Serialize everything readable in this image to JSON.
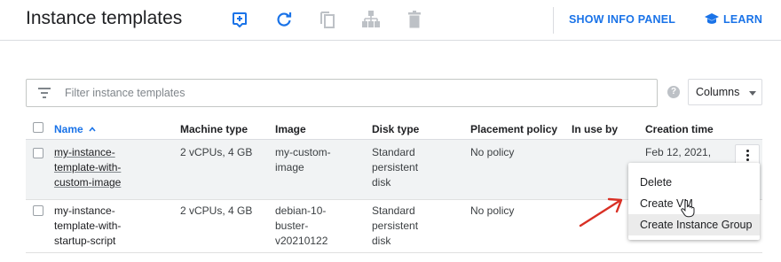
{
  "header": {
    "title": "Instance templates",
    "actions": [
      {
        "icon": "add-box-icon",
        "color": "#1a73e8"
      },
      {
        "icon": "refresh-icon",
        "color": "#1a73e8"
      },
      {
        "icon": "copy-icon",
        "color": "#bdc1c6"
      },
      {
        "icon": "instance-group-icon",
        "color": "#bdc1c6"
      },
      {
        "icon": "delete-icon",
        "color": "#bdc1c6"
      }
    ],
    "show_info_panel": "SHOW INFO PANEL",
    "learn": "LEARN"
  },
  "filter": {
    "placeholder": "Filter instance templates",
    "columns_label": "Columns"
  },
  "table": {
    "columns": [
      "Name",
      "Machine type",
      "Image",
      "Disk type",
      "Placement policy",
      "In use by",
      "Creation time"
    ],
    "sort_indicator": "^",
    "rows": [
      {
        "name": "my-instance-template-with-custom-image",
        "machine_type": "2 vCPUs, 4 GB",
        "image": "my-custom-image",
        "disk_type": "Standard persistent disk",
        "placement_policy": "No policy",
        "in_use_by": "",
        "creation_time": "Feb 12, 2021,"
      },
      {
        "name": "my-instance-template-with-startup-script",
        "machine_type": "2 vCPUs, 4 GB",
        "image": "debian-10-buster-v20210122",
        "disk_type": "Standard persistent disk",
        "placement_policy": "No policy",
        "in_use_by": "",
        "creation_time": ""
      }
    ]
  },
  "context_menu": {
    "items": [
      "Delete",
      "Create VM",
      "Create Instance Group"
    ],
    "highlighted_index": 2
  },
  "colors": {
    "accent": "#1a73e8",
    "annotation_arrow": "#d93025",
    "disabled_icon": "#bdc1c6"
  }
}
